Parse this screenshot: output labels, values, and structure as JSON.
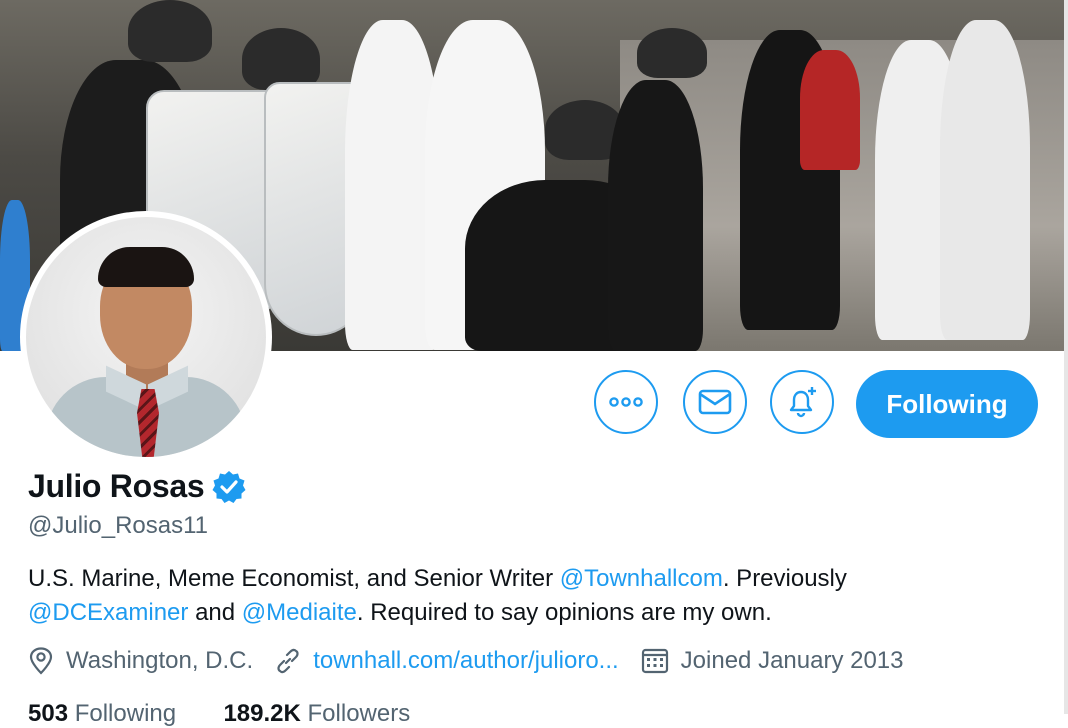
{
  "profile": {
    "name": "Julio Rosas",
    "handle": "@Julio_Rosas11",
    "verified_icon": "verified-badge-icon",
    "bio": {
      "t1": "U.S. Marine, Meme Economist, and Senior Writer ",
      "mention1": "@Townhallcom",
      "t2": ". Previously ",
      "mention2": "@DCExaminer",
      "t3": " and ",
      "mention3": "@Mediaite",
      "t4": ". Required to say opinions are my own."
    },
    "location": "Washington, D.C.",
    "website": "townhall.com/author/julioro...",
    "joined": "Joined January 2013"
  },
  "actions": {
    "more_icon": "more-dots-icon",
    "message_icon": "mail-icon",
    "notify_icon": "bell-plus-icon",
    "follow_label": "Following"
  },
  "stats": {
    "following_count": "503",
    "following_label": "Following",
    "followers_count": "189.2K",
    "followers_label": "Followers"
  },
  "colors": {
    "accent": "#1d9bf0",
    "secondary_text": "#536471",
    "primary_text": "#0f1419"
  }
}
